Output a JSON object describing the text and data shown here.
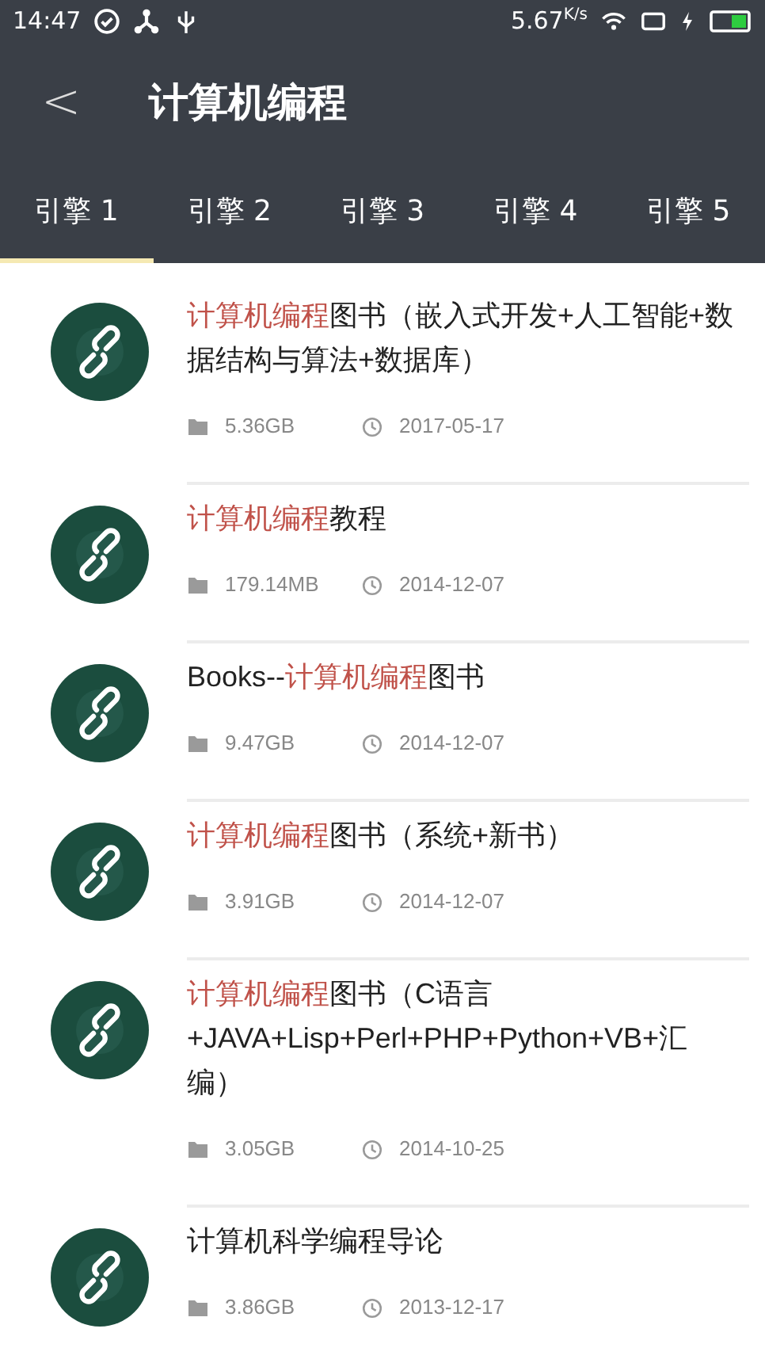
{
  "status_bar": {
    "time": "14:47",
    "speed": "5.67",
    "speed_unit": "K/s"
  },
  "header": {
    "back": "<",
    "title": "计算机编程"
  },
  "tabs": [
    {
      "label": "引擎 1",
      "selected": true
    },
    {
      "label": "引擎 2",
      "selected": false
    },
    {
      "label": "引擎 3",
      "selected": false
    },
    {
      "label": "引擎 4",
      "selected": false
    },
    {
      "label": "引擎 5",
      "selected": false
    }
  ],
  "results": [
    {
      "title": [
        {
          "text": "计算机编程",
          "highlighted": true
        },
        {
          "text": "图书（嵌入式开发+人工智能+数据结构与算法+数据库）",
          "highlighted": false
        }
      ],
      "size": "5.36GB",
      "date": "2017-05-17"
    },
    {
      "title": [
        {
          "text": "计算机编程",
          "highlighted": true
        },
        {
          "text": "教程",
          "highlighted": false
        }
      ],
      "size": "179.14MB",
      "date": "2014-12-07"
    },
    {
      "title": [
        {
          "text": "Books--",
          "highlighted": false
        },
        {
          "text": "计算机编程",
          "highlighted": true
        },
        {
          "text": "图书",
          "highlighted": false
        }
      ],
      "size": "9.47GB",
      "date": "2014-12-07"
    },
    {
      "title": [
        {
          "text": "计算机编程",
          "highlighted": true
        },
        {
          "text": "图书（系统+新书）",
          "highlighted": false
        }
      ],
      "size": "3.91GB",
      "date": "2014-12-07"
    },
    {
      "title": [
        {
          "text": "计算机编程",
          "highlighted": true
        },
        {
          "text": "图书（C语言+JAVA+Lisp+Perl+PHP+Python+VB+汇编）",
          "highlighted": false
        }
      ],
      "size": "3.05GB",
      "date": "2014-10-25"
    },
    {
      "title": [
        {
          "text": "计算机科学编程导论",
          "highlighted": false
        }
      ],
      "size": "3.86GB",
      "date": "2013-12-17"
    }
  ]
}
